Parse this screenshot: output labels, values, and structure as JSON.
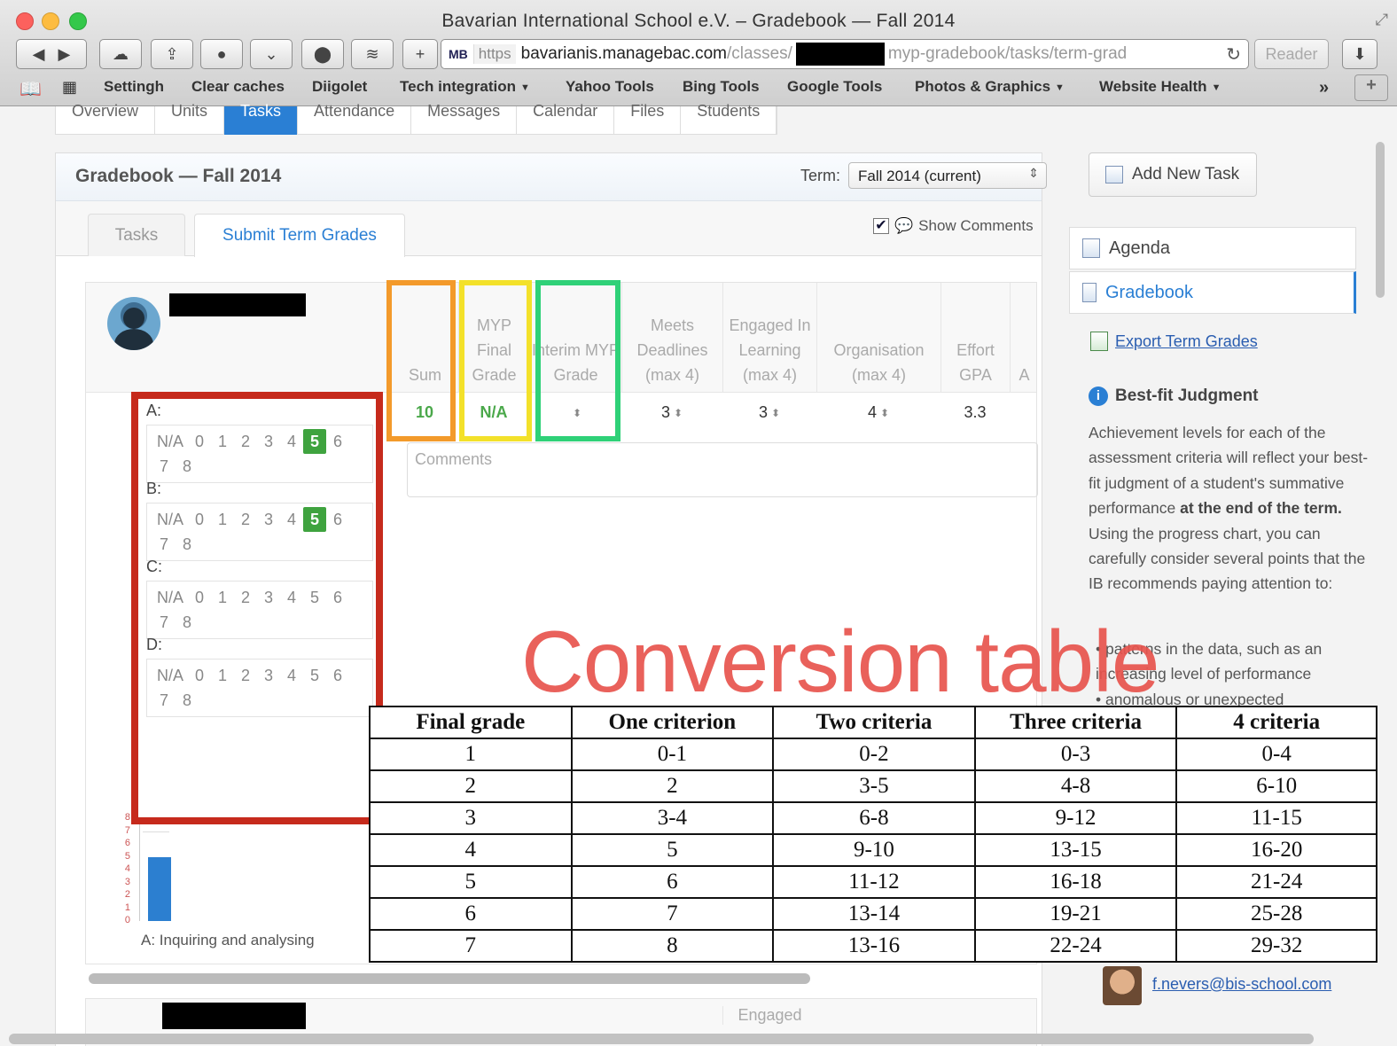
{
  "browser": {
    "window_title": "Bavarian International School e.V. – Gradebook — Fall 2014",
    "url": {
      "mb": "MB",
      "https": "https",
      "host": "bavarianis.managebac.com",
      "path1": "/classes/",
      "path2": "myp-gradebook/tasks/term-grad"
    },
    "reader_label": "Reader",
    "bookmarks": [
      {
        "label": "Settingh",
        "arrow": ""
      },
      {
        "label": "Clear caches",
        "arrow": ""
      },
      {
        "label": "Diigolet",
        "arrow": ""
      },
      {
        "label": "Tech integration",
        "arrow": "▼"
      },
      {
        "label": "Yahoo Tools",
        "arrow": ""
      },
      {
        "label": "Bing Tools",
        "arrow": ""
      },
      {
        "label": "Google Tools",
        "arrow": ""
      },
      {
        "label": "Photos & Graphics",
        "arrow": "▼"
      },
      {
        "label": "Website Health",
        "arrow": "▼"
      }
    ],
    "overflow": "»",
    "new_tab": "+"
  },
  "nav_tabs": [
    "Overview",
    "Units",
    "Tasks",
    "Attendance",
    "Messages",
    "Calendar",
    "Files",
    "Students"
  ],
  "gradebook": {
    "title": "Gradebook — Fall 2014",
    "term_label": "Term:",
    "term_value": "Fall 2014 (current)",
    "tabs": [
      "Tasks",
      "Submit Term Grades"
    ],
    "show_comments": "Show Comments",
    "columns": [
      {
        "head": "Sum",
        "value": "10"
      },
      {
        "head": "MYP Final Grade",
        "value": "N/A"
      },
      {
        "head": "Interim MYP Grade",
        "value": ""
      },
      {
        "head": "Meets Deadlines (max 4)",
        "value": "3"
      },
      {
        "head": "Engaged In Learning (max 4)",
        "value": "3"
      },
      {
        "head": "Organisation (max 4)",
        "value": "4"
      },
      {
        "head": "Effort GPA",
        "value": "3.3"
      },
      {
        "head": "A",
        "value": ""
      }
    ],
    "comments_placeholder": "Comments",
    "criteria": [
      {
        "label": "A:",
        "levels": [
          "N/A",
          "0",
          "1",
          "2",
          "3",
          "4",
          "5",
          "6",
          "7",
          "8"
        ],
        "selected": "5"
      },
      {
        "label": "B:",
        "levels": [
          "N/A",
          "0",
          "1",
          "2",
          "3",
          "4",
          "5",
          "6",
          "7",
          "8"
        ],
        "selected": "5"
      },
      {
        "label": "C:",
        "levels": [
          "N/A",
          "0",
          "1",
          "2",
          "3",
          "4",
          "5",
          "6",
          "7",
          "8"
        ],
        "selected": ""
      },
      {
        "label": "D:",
        "levels": [
          "N/A",
          "0",
          "1",
          "2",
          "3",
          "4",
          "5",
          "6",
          "7",
          "8"
        ],
        "selected": ""
      }
    ],
    "mini_chart": {
      "ticks": [
        "8",
        "7",
        "6",
        "5",
        "4",
        "3",
        "2",
        "1",
        "0"
      ],
      "bar_value": 5,
      "y_max": 8,
      "caption": "A: Inquiring and analysing"
    },
    "student2_col": "Engaged"
  },
  "sidebar": {
    "add_task": "Add New Task",
    "menu": [
      "Agenda",
      "Gradebook"
    ],
    "export": "Export Term Grades",
    "bestfit_title": "Best-fit Judgment",
    "bestfit_text_1": "Achievement levels for each of the assessment criteria will reflect your best-fit judgment of a student's summative performance ",
    "bestfit_bold": "at the end of the term.",
    "bestfit_text_2": " Using the progress chart, you can carefully consider several points that the IB recommends paying attention to:",
    "bullet": "patterns in the data, such as an increasing level of performance",
    "bullet_2": "anomalous or unexpected",
    "teacher_email": "f.nevers@bis-school.com"
  },
  "conversion": {
    "title": "Conversion table",
    "headers": [
      "Final grade",
      "One criterion",
      "Two criteria",
      "Three criteria",
      "4 criteria"
    ],
    "rows": [
      [
        "1",
        "0-1",
        "0-2",
        "0-3",
        "0-4"
      ],
      [
        "2",
        "2",
        "3-5",
        "4-8",
        "6-10"
      ],
      [
        "3",
        "3-4",
        "6-8",
        "9-12",
        "11-15"
      ],
      [
        "4",
        "5",
        "9-10",
        "13-15",
        "16-20"
      ],
      [
        "5",
        "6",
        "11-12",
        "16-18",
        "21-24"
      ],
      [
        "6",
        "7",
        "13-14",
        "19-21",
        "25-28"
      ],
      [
        "7",
        "8",
        "13-16",
        "22-24",
        "29-32"
      ]
    ]
  },
  "colors": {
    "accent": "#2a7fd4",
    "selected_level": "#3fa33f",
    "box_orange": "#f39a2b",
    "box_yellow": "#f3e12a",
    "box_green": "#2fd178",
    "box_red": "#c62a1c",
    "conversion_title": "#e8544e"
  }
}
